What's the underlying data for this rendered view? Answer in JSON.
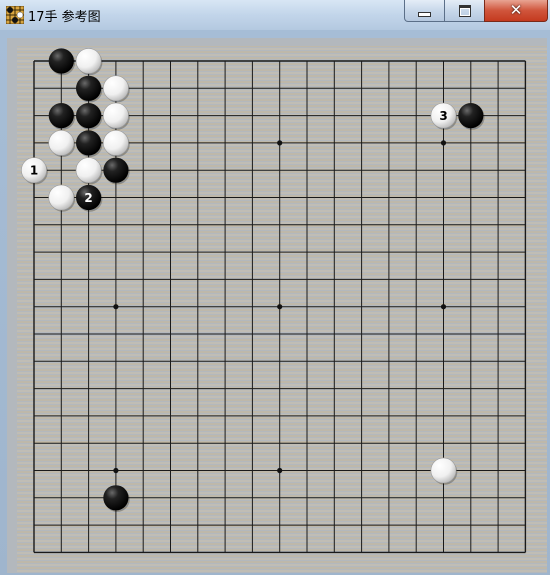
{
  "window": {
    "title": "17手 参考图",
    "controls": {
      "minimize": "minimize",
      "maximize": "maximize",
      "close": "close"
    }
  },
  "board": {
    "size": 19,
    "board_color": "#f3c878",
    "line_color": "#1a1a1a",
    "star_points": [
      [
        4,
        4
      ],
      [
        10,
        4
      ],
      [
        16,
        4
      ],
      [
        4,
        10
      ],
      [
        10,
        10
      ],
      [
        16,
        10
      ],
      [
        4,
        16
      ],
      [
        10,
        16
      ],
      [
        16,
        16
      ]
    ],
    "stones": [
      {
        "col": 2,
        "row": 1,
        "color": "black"
      },
      {
        "col": 3,
        "row": 1,
        "color": "white"
      },
      {
        "col": 3,
        "row": 2,
        "color": "black"
      },
      {
        "col": 4,
        "row": 2,
        "color": "white"
      },
      {
        "col": 2,
        "row": 3,
        "color": "black"
      },
      {
        "col": 3,
        "row": 3,
        "color": "black"
      },
      {
        "col": 4,
        "row": 3,
        "color": "white"
      },
      {
        "col": 2,
        "row": 4,
        "color": "white"
      },
      {
        "col": 3,
        "row": 4,
        "color": "black"
      },
      {
        "col": 4,
        "row": 4,
        "color": "white"
      },
      {
        "col": 1,
        "row": 5,
        "color": "white",
        "label": "1"
      },
      {
        "col": 3,
        "row": 5,
        "color": "white"
      },
      {
        "col": 4,
        "row": 5,
        "color": "black"
      },
      {
        "col": 2,
        "row": 6,
        "color": "white"
      },
      {
        "col": 3,
        "row": 6,
        "color": "black",
        "label": "2"
      },
      {
        "col": 16,
        "row": 3,
        "color": "white",
        "label": "3"
      },
      {
        "col": 17,
        "row": 3,
        "color": "black"
      },
      {
        "col": 16,
        "row": 16,
        "color": "white"
      },
      {
        "col": 4,
        "row": 17,
        "color": "black"
      }
    ]
  }
}
